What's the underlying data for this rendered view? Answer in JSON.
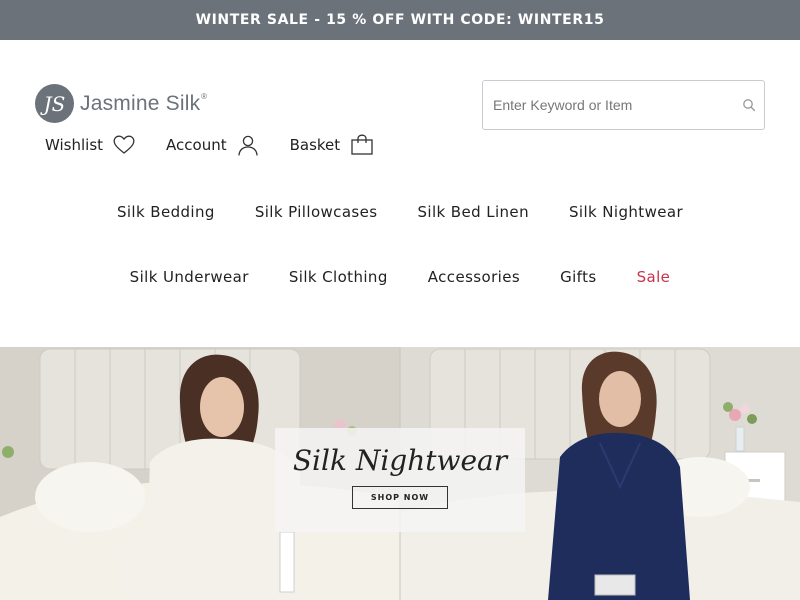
{
  "promo": {
    "text": "WINTER SALE - 15 % OFF WITH CODE: WINTER15"
  },
  "brand": {
    "name": "Jasmine Silk",
    "registered": "®",
    "monogram": "JS"
  },
  "search": {
    "placeholder": "Enter Keyword or Item",
    "value": ""
  },
  "account_links": [
    {
      "label": "Wishlist",
      "icon": "heart-icon"
    },
    {
      "label": "Account",
      "icon": "user-icon"
    },
    {
      "label": "Basket",
      "icon": "bag-icon"
    }
  ],
  "nav": {
    "row1": [
      {
        "label": "Silk Bedding"
      },
      {
        "label": "Silk Pillowcases"
      },
      {
        "label": "Silk Bed Linen"
      },
      {
        "label": "Silk Nightwear"
      }
    ],
    "row2": [
      {
        "label": "Silk Underwear"
      },
      {
        "label": "Silk Clothing"
      },
      {
        "label": "Accessories"
      },
      {
        "label": "Gifts"
      },
      {
        "label": "Sale"
      }
    ]
  },
  "hero": {
    "title": "Silk Nightwear",
    "button_label": "SHOP NOW"
  },
  "colors": {
    "promo_bg": "#6c727a",
    "sale_accent": "#c8324c",
    "brand_grey": "#6c727a",
    "navy_pajama": "#1f2d5c"
  }
}
